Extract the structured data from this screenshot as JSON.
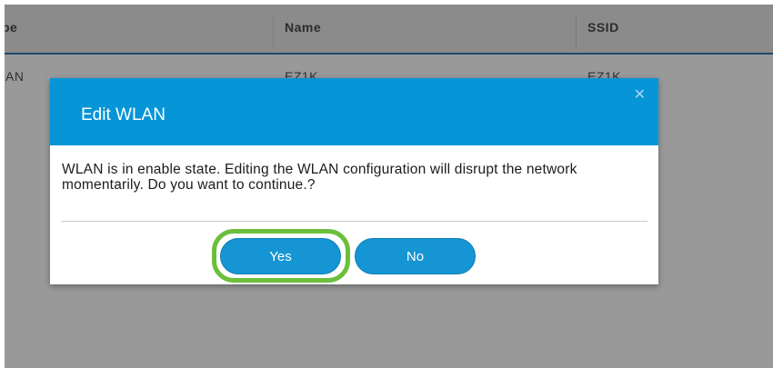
{
  "table": {
    "columns": [
      "pe",
      "Name",
      "SSID"
    ],
    "row": [
      "AN",
      "EZ1K",
      "EZ1K"
    ]
  },
  "dialog": {
    "title": "Edit WLAN",
    "close_glyph": "✕",
    "message": "WLAN is in enable state. Editing the WLAN configuration will disrupt the network momentarily. Do you want to continue.?",
    "yes_label": "Yes",
    "no_label": "No"
  },
  "colors": {
    "header_blue": "#0695d6",
    "button_blue": "#1595d3",
    "highlight_green": "#6cbf3c"
  }
}
